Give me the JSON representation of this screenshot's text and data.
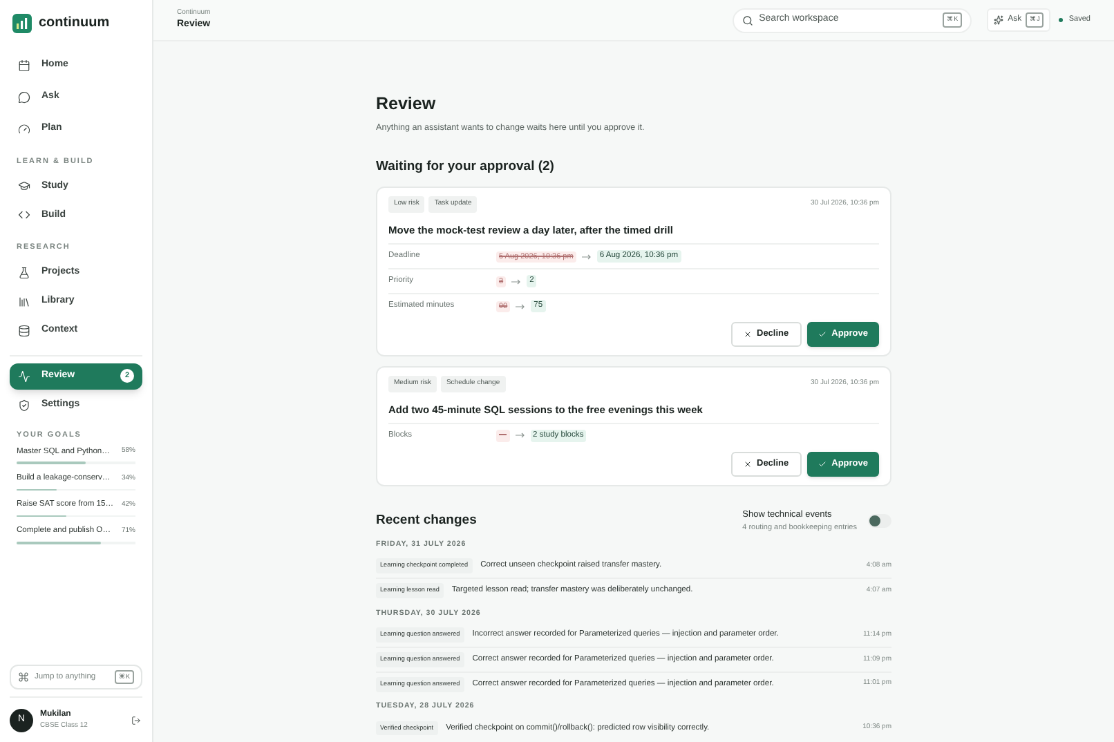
{
  "brand": {
    "name": "continuum"
  },
  "nav": {
    "items": [
      {
        "label": "Home",
        "selected": false
      },
      {
        "label": "Ask",
        "selected": false
      },
      {
        "label": "Plan",
        "selected": false
      }
    ],
    "sections": [
      {
        "title": "LEARN & BUILD",
        "items": [
          {
            "label": "Study",
            "selected": false
          },
          {
            "label": "Build",
            "selected": false
          }
        ]
      },
      {
        "title": "RESEARCH",
        "items": [
          {
            "label": "Projects",
            "selected": false
          },
          {
            "label": "Library",
            "selected": false
          },
          {
            "label": "Context",
            "selected": false
          }
        ]
      }
    ],
    "bottom_items": [
      {
        "label": "Review",
        "selected": true,
        "badge": "2"
      },
      {
        "label": "Settings",
        "selected": false
      }
    ]
  },
  "goals": {
    "title": "YOUR GOALS",
    "items": [
      {
        "name": "Master SQL and Python…",
        "reading": "58%",
        "level": 0.58
      },
      {
        "name": "Build a leakage-conserv…",
        "reading": "34%",
        "level": 0.34
      },
      {
        "name": "Raise SAT score from 15…",
        "reading": "42%",
        "level": 0.42
      },
      {
        "name": "Complete and publish O…",
        "reading": "71%",
        "level": 0.71
      }
    ]
  },
  "jump": {
    "placeholder": "Jump to anything",
    "shortcut": "⌘K"
  },
  "user": {
    "initial": "N",
    "name": "Mukilan",
    "subtitle": "CBSE Class 12"
  },
  "header": {
    "breadcrumb": "Continuum",
    "title": "Review",
    "search_placeholder": "Search workspace",
    "search_shortcut": "⌘K",
    "ask_label": "Ask",
    "ask_shortcut": "⌘J",
    "status": "Saved"
  },
  "page": {
    "title": "Review",
    "subtitle": "Anything an assistant wants to change waits here until you approve it.",
    "pending_title": "Waiting for your approval (2)"
  },
  "proposals": [
    {
      "tags": [
        "Low risk",
        "Task update"
      ],
      "time": "30 Jul 2026, 10:36 pm",
      "title": "Move the mock-test review a day later, after the timed drill",
      "changes": [
        {
          "field": "Deadline",
          "old": "5 Aug 2026, 10:36 pm",
          "new": "6 Aug 2026, 10:36 pm"
        },
        {
          "field": "Priority",
          "old": "3",
          "new": "2"
        },
        {
          "field": "Estimated minutes",
          "old": "90",
          "new": "75"
        }
      ],
      "decline": "Decline",
      "approve": "Approve"
    },
    {
      "tags": [
        "Medium risk",
        "Schedule change"
      ],
      "time": "30 Jul 2026, 10:36 pm",
      "title": "Add two 45-minute SQL sessions to the free evenings this week",
      "changes": [
        {
          "field": "Blocks",
          "old": "—",
          "new": "2 study blocks"
        }
      ],
      "decline": "Decline",
      "approve": "Approve"
    }
  ],
  "recent": {
    "title": "Recent changes",
    "toggle_label": "Show technical events",
    "toggle_hint": "4 routing and bookkeeping entries",
    "toggle_on": false,
    "days": [
      {
        "date": "FRIDAY, 31 JULY 2026",
        "events": [
          {
            "tag": "Learning checkpoint completed",
            "text": "Correct unseen checkpoint raised transfer mastery.",
            "time": "4:08 am"
          },
          {
            "tag": "Learning lesson read",
            "text": "Targeted lesson read; transfer mastery was deliberately unchanged.",
            "time": "4:07 am"
          }
        ]
      },
      {
        "date": "THURSDAY, 30 JULY 2026",
        "events": [
          {
            "tag": "Learning question answered",
            "text": "Incorrect answer recorded for Parameterized queries — injection and parameter order.",
            "time": "11:14 pm"
          },
          {
            "tag": "Learning question answered",
            "text": "Correct answer recorded for Parameterized queries — injection and parameter order.",
            "time": "11:09 pm"
          },
          {
            "tag": "Learning question answered",
            "text": "Correct answer recorded for Parameterized queries — injection and parameter order.",
            "time": "11:01 pm"
          }
        ]
      },
      {
        "date": "TUESDAY, 28 JULY 2026",
        "events": [
          {
            "tag": "Verified checkpoint",
            "text": "Verified checkpoint on commit()/rollback(): predicted row visibility correctly.",
            "time": "10:36 pm"
          }
        ]
      }
    ]
  }
}
